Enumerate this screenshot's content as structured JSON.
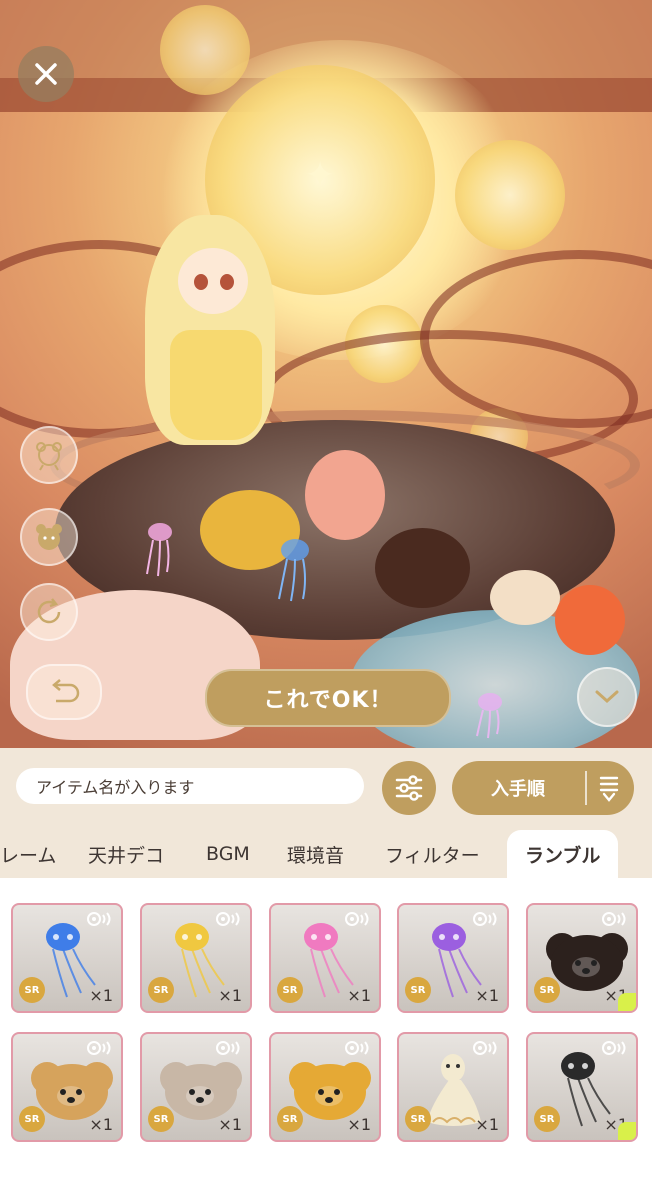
{
  "buttons": {
    "ok_label": "これでOK！",
    "sort_label": "入手順"
  },
  "search": {
    "value": "アイテム名が入ります"
  },
  "tabs": [
    {
      "label": "レーム"
    },
    {
      "label": "天井デコ"
    },
    {
      "label": "BGM"
    },
    {
      "label": "環境音"
    },
    {
      "label": "フィルター"
    },
    {
      "label": "ランブル",
      "active": true
    }
  ],
  "items": [
    {
      "icon": "jellyfish-blue-icon",
      "color": "#3f7de8",
      "rarity": "SR",
      "qty": "×1"
    },
    {
      "icon": "jellyfish-yellow-icon",
      "color": "#f0c840",
      "rarity": "SR",
      "qty": "×1"
    },
    {
      "icon": "jellyfish-pink-icon",
      "color": "#f07ac0",
      "rarity": "SR",
      "qty": "×1"
    },
    {
      "icon": "jellyfish-purple-icon",
      "color": "#9b5fe0",
      "rarity": "SR",
      "qty": "×1"
    },
    {
      "icon": "fluffy-black-creature-icon",
      "color": "#2c211d",
      "rarity": "SR",
      "qty": "×1",
      "new": true
    },
    {
      "icon": "fluffy-cream-brown-creature-icon",
      "color": "#d6a35c",
      "rarity": "SR",
      "qty": "×1"
    },
    {
      "icon": "fluffy-grey-creature-icon",
      "color": "#c8b7a6",
      "rarity": "SR",
      "qty": "×1"
    },
    {
      "icon": "fluffy-yellow-chick-icon",
      "color": "#e5a935",
      "rarity": "SR",
      "qty": "×1"
    },
    {
      "icon": "white-bird-creature-icon",
      "color": "#f3ead0",
      "rarity": "SR",
      "qty": "×1"
    },
    {
      "icon": "jellyfish-black-icon",
      "color": "#2a2a2a",
      "rarity": "SR",
      "qty": "×1",
      "new": true
    }
  ],
  "colors": {
    "accent_gold": "#bf9e5f",
    "card_border": "#e29aa8",
    "rarity_badge": "#d9a73f",
    "new_marker": "#d9f04a"
  }
}
